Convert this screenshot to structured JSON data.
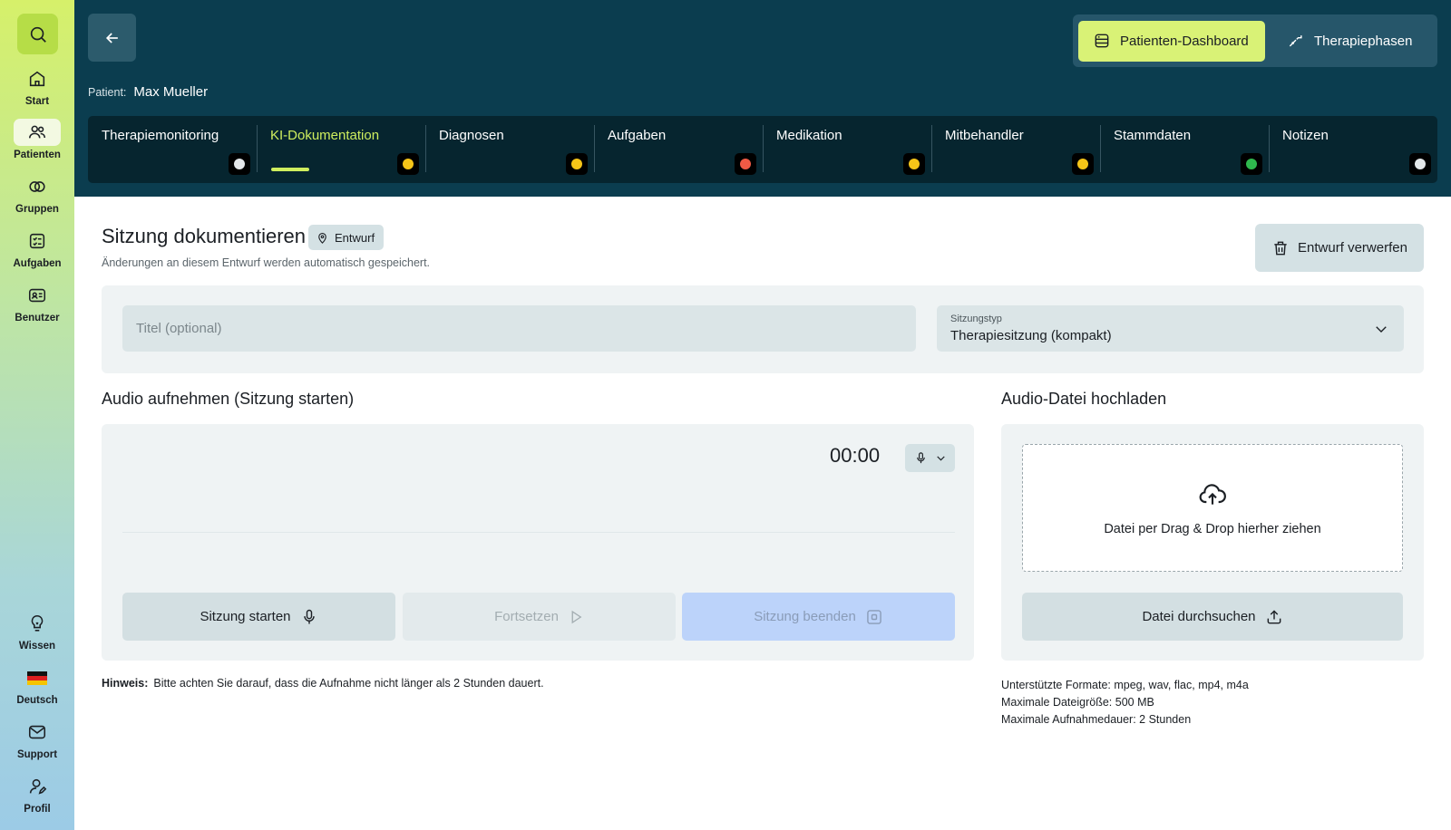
{
  "sidebar": {
    "items": [
      {
        "label": "Start",
        "icon": "home-icon"
      },
      {
        "label": "Patienten",
        "icon": "users-icon"
      },
      {
        "label": "Gruppen",
        "icon": "groups-icon"
      },
      {
        "label": "Aufgaben",
        "icon": "checklist-icon"
      },
      {
        "label": "Benutzer",
        "icon": "id-card-icon"
      }
    ],
    "bottom_items": [
      {
        "label": "Wissen",
        "icon": "lightbulb-icon"
      },
      {
        "label": "Deutsch",
        "icon": "flag-de-icon"
      },
      {
        "label": "Support",
        "icon": "mail-icon"
      },
      {
        "label": "Profil",
        "icon": "profile-icon"
      }
    ]
  },
  "header": {
    "patient_key": "Patient:",
    "patient_name": "Max Mueller",
    "switch": {
      "dashboard": "Patienten-Dashboard",
      "phases": "Therapiephasen"
    },
    "tabs": [
      {
        "label": "Therapiemonitoring",
        "status": "#e4e8ea"
      },
      {
        "label": "KI-Dokumentation",
        "status": "#f5c518"
      },
      {
        "label": "Diagnosen",
        "status": "#f5c518"
      },
      {
        "label": "Aufgaben",
        "status": "#f05a45"
      },
      {
        "label": "Medikation",
        "status": "#f5c518"
      },
      {
        "label": "Mitbehandler",
        "status": "#f5c518"
      },
      {
        "label": "Stammdaten",
        "status": "#2fb84e"
      },
      {
        "label": "Notizen",
        "status": "#e4e8ea"
      }
    ]
  },
  "main": {
    "title": "Sitzung dokumentieren",
    "badge": "Entwurf",
    "subtitle": "Änderungen an diesem Entwurf werden automatisch gespeichert.",
    "discard_label": "Entwurf verwerfen",
    "title_placeholder": "Titel (optional)",
    "type_label": "Sitzungstyp",
    "type_value": "Therapiesitzung (kompakt)",
    "record": {
      "heading": "Audio aufnehmen (Sitzung starten)",
      "timer": "00:00",
      "start": "Sitzung starten",
      "resume": "Fortsetzen",
      "end": "Sitzung beenden"
    },
    "upload": {
      "heading": "Audio-Datei hochladen",
      "drop_text": "Datei per Drag & Drop hierher ziehen",
      "browse": "Datei durchsuchen"
    },
    "hint_label": "Hinweis:",
    "hint_text": "Bitte achten Sie darauf, dass die Aufnahme nicht länger als 2 Stunden dauert.",
    "formats": [
      "Unterstützte Formate: mpeg, wav, flac, mp4, m4a",
      "Maximale Dateigröße: 500 MB",
      "Maximale Aufnahmedauer: 2 Stunden"
    ]
  }
}
